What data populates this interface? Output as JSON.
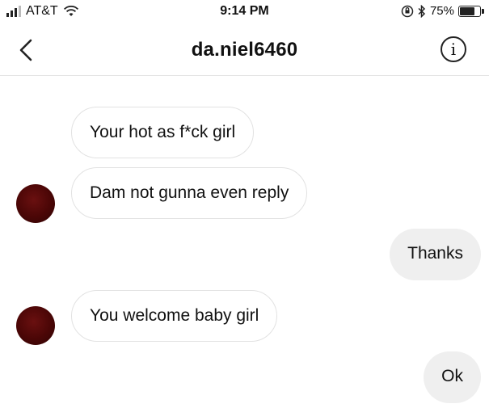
{
  "status_bar": {
    "carrier": "AT&T",
    "time": "9:14 PM",
    "battery_percent": "75%"
  },
  "header": {
    "username": "da.niel6460",
    "back_icon": "chevron-left-icon",
    "info_icon": "info-icon"
  },
  "messages": [
    {
      "direction": "incoming",
      "text": "Your hot as f*ck girl"
    },
    {
      "direction": "incoming",
      "text": "Dam not gunna even reply"
    },
    {
      "direction": "outgoing",
      "text": "Thanks"
    },
    {
      "direction": "incoming",
      "text": "You welcome baby girl"
    },
    {
      "direction": "outgoing",
      "text": "Ok"
    }
  ],
  "colors": {
    "incoming_bubble_border": "#e2e2e2",
    "outgoing_bubble_bg": "#efefef",
    "avatar": "#4a0606"
  }
}
